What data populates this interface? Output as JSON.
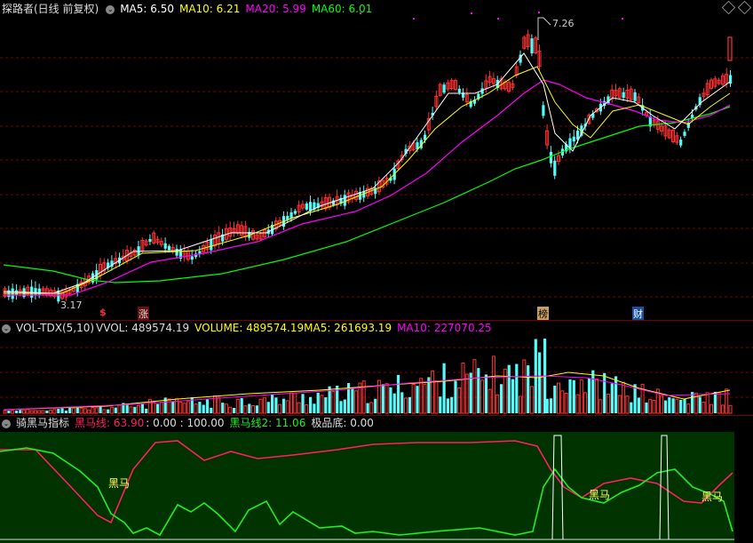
{
  "main": {
    "title": "探路者(日线 前复权)",
    "ma5": "MA5: 6.50",
    "ma10": "MA10: 6.21",
    "ma20": "MA20: 5.99",
    "ma60": "MA60: 6.01",
    "high_label": "7.26",
    "low_label": "3.17",
    "markers": [
      "$",
      "涨",
      "榜",
      "财"
    ]
  },
  "volume": {
    "title": "VOL-TDX(5,10)",
    "vvol": "VVOL: 489574.19",
    "vol": "VOLUME: 489574.19",
    "ma5": "MA5: 261693.19",
    "ma10": "MA10: 227070.25"
  },
  "indicator": {
    "title": "骑黑马指标",
    "line1": "黑马线: 63.90",
    "vals": ": 0.00 : 100.00",
    "line2": "黑马线2: 11.06",
    "bottom": "极品底: 0.00",
    "signal": "黑马"
  },
  "colors": {
    "up": "#ff3232",
    "down": "#54fcfc",
    "ma5": "#ffffff",
    "ma10": "#ffff00",
    "ma20": "#ff00ff",
    "ma60": "#00ff00",
    "red_line": "#ff2060",
    "green_line": "#22ee22",
    "grid": "#7a0000"
  }
}
